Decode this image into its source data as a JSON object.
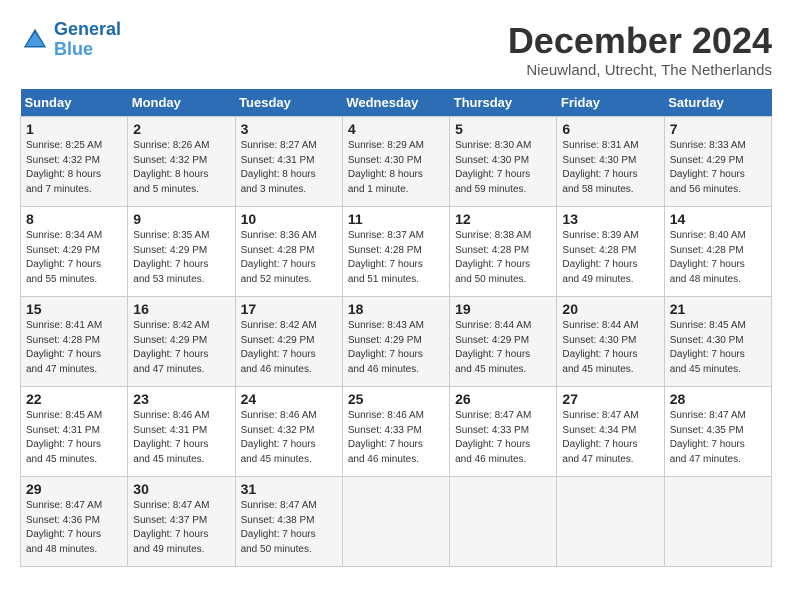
{
  "header": {
    "logo_line1": "General",
    "logo_line2": "Blue",
    "month": "December 2024",
    "location": "Nieuwland, Utrecht, The Netherlands"
  },
  "weekdays": [
    "Sunday",
    "Monday",
    "Tuesday",
    "Wednesday",
    "Thursday",
    "Friday",
    "Saturday"
  ],
  "weeks": [
    [
      {
        "day": "1",
        "info": "Sunrise: 8:25 AM\nSunset: 4:32 PM\nDaylight: 8 hours\nand 7 minutes."
      },
      {
        "day": "2",
        "info": "Sunrise: 8:26 AM\nSunset: 4:32 PM\nDaylight: 8 hours\nand 5 minutes."
      },
      {
        "day": "3",
        "info": "Sunrise: 8:27 AM\nSunset: 4:31 PM\nDaylight: 8 hours\nand 3 minutes."
      },
      {
        "day": "4",
        "info": "Sunrise: 8:29 AM\nSunset: 4:30 PM\nDaylight: 8 hours\nand 1 minute."
      },
      {
        "day": "5",
        "info": "Sunrise: 8:30 AM\nSunset: 4:30 PM\nDaylight: 7 hours\nand 59 minutes."
      },
      {
        "day": "6",
        "info": "Sunrise: 8:31 AM\nSunset: 4:30 PM\nDaylight: 7 hours\nand 58 minutes."
      },
      {
        "day": "7",
        "info": "Sunrise: 8:33 AM\nSunset: 4:29 PM\nDaylight: 7 hours\nand 56 minutes."
      }
    ],
    [
      {
        "day": "8",
        "info": "Sunrise: 8:34 AM\nSunset: 4:29 PM\nDaylight: 7 hours\nand 55 minutes."
      },
      {
        "day": "9",
        "info": "Sunrise: 8:35 AM\nSunset: 4:29 PM\nDaylight: 7 hours\nand 53 minutes."
      },
      {
        "day": "10",
        "info": "Sunrise: 8:36 AM\nSunset: 4:28 PM\nDaylight: 7 hours\nand 52 minutes."
      },
      {
        "day": "11",
        "info": "Sunrise: 8:37 AM\nSunset: 4:28 PM\nDaylight: 7 hours\nand 51 minutes."
      },
      {
        "day": "12",
        "info": "Sunrise: 8:38 AM\nSunset: 4:28 PM\nDaylight: 7 hours\nand 50 minutes."
      },
      {
        "day": "13",
        "info": "Sunrise: 8:39 AM\nSunset: 4:28 PM\nDaylight: 7 hours\nand 49 minutes."
      },
      {
        "day": "14",
        "info": "Sunrise: 8:40 AM\nSunset: 4:28 PM\nDaylight: 7 hours\nand 48 minutes."
      }
    ],
    [
      {
        "day": "15",
        "info": "Sunrise: 8:41 AM\nSunset: 4:28 PM\nDaylight: 7 hours\nand 47 minutes."
      },
      {
        "day": "16",
        "info": "Sunrise: 8:42 AM\nSunset: 4:29 PM\nDaylight: 7 hours\nand 47 minutes."
      },
      {
        "day": "17",
        "info": "Sunrise: 8:42 AM\nSunset: 4:29 PM\nDaylight: 7 hours\nand 46 minutes."
      },
      {
        "day": "18",
        "info": "Sunrise: 8:43 AM\nSunset: 4:29 PM\nDaylight: 7 hours\nand 46 minutes."
      },
      {
        "day": "19",
        "info": "Sunrise: 8:44 AM\nSunset: 4:29 PM\nDaylight: 7 hours\nand 45 minutes."
      },
      {
        "day": "20",
        "info": "Sunrise: 8:44 AM\nSunset: 4:30 PM\nDaylight: 7 hours\nand 45 minutes."
      },
      {
        "day": "21",
        "info": "Sunrise: 8:45 AM\nSunset: 4:30 PM\nDaylight: 7 hours\nand 45 minutes."
      }
    ],
    [
      {
        "day": "22",
        "info": "Sunrise: 8:45 AM\nSunset: 4:31 PM\nDaylight: 7 hours\nand 45 minutes."
      },
      {
        "day": "23",
        "info": "Sunrise: 8:46 AM\nSunset: 4:31 PM\nDaylight: 7 hours\nand 45 minutes."
      },
      {
        "day": "24",
        "info": "Sunrise: 8:46 AM\nSunset: 4:32 PM\nDaylight: 7 hours\nand 45 minutes."
      },
      {
        "day": "25",
        "info": "Sunrise: 8:46 AM\nSunset: 4:33 PM\nDaylight: 7 hours\nand 46 minutes."
      },
      {
        "day": "26",
        "info": "Sunrise: 8:47 AM\nSunset: 4:33 PM\nDaylight: 7 hours\nand 46 minutes."
      },
      {
        "day": "27",
        "info": "Sunrise: 8:47 AM\nSunset: 4:34 PM\nDaylight: 7 hours\nand 47 minutes."
      },
      {
        "day": "28",
        "info": "Sunrise: 8:47 AM\nSunset: 4:35 PM\nDaylight: 7 hours\nand 47 minutes."
      }
    ],
    [
      {
        "day": "29",
        "info": "Sunrise: 8:47 AM\nSunset: 4:36 PM\nDaylight: 7 hours\nand 48 minutes."
      },
      {
        "day": "30",
        "info": "Sunrise: 8:47 AM\nSunset: 4:37 PM\nDaylight: 7 hours\nand 49 minutes."
      },
      {
        "day": "31",
        "info": "Sunrise: 8:47 AM\nSunset: 4:38 PM\nDaylight: 7 hours\nand 50 minutes."
      },
      null,
      null,
      null,
      null
    ]
  ]
}
